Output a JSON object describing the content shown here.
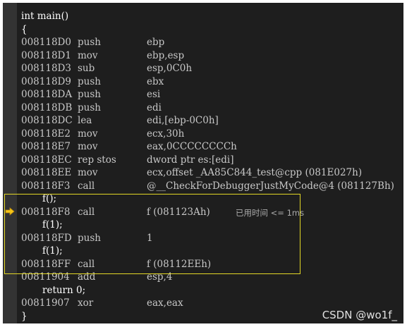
{
  "source_lines": {
    "main_sig": "int main()",
    "open_brace": "{",
    "call_f": "f();",
    "call_f1_a": "f(1);",
    "call_f1_b": "f(1);",
    "return": "return 0;",
    "close_brace": "}"
  },
  "asm": [
    {
      "addr": "008118D0",
      "op": "push",
      "args": "ebp"
    },
    {
      "addr": "008118D1",
      "op": "mov",
      "args": "ebp,esp"
    },
    {
      "addr": "008118D3",
      "op": "sub",
      "args": "esp,0C0h"
    },
    {
      "addr": "008118D9",
      "op": "push",
      "args": "ebx"
    },
    {
      "addr": "008118DA",
      "op": "push",
      "args": "esi"
    },
    {
      "addr": "008118DB",
      "op": "push",
      "args": "edi"
    },
    {
      "addr": "008118DC",
      "op": "lea",
      "args": "edi,[ebp-0C0h]"
    },
    {
      "addr": "008118E2",
      "op": "mov",
      "args": "ecx,30h"
    },
    {
      "addr": "008118E7",
      "op": "mov",
      "args": "eax,0CCCCCCCCh"
    },
    {
      "addr": "008118EC",
      "op": "rep stos",
      "args": "dword ptr es:[edi]"
    },
    {
      "addr": "008118EE",
      "op": "mov",
      "args": "ecx,offset _AA85C844_test@cpp (081E027h)"
    },
    {
      "addr": "008118F3",
      "op": "call",
      "args": "@__CheckForDebuggerJustMyCode@4 (081127Bh)"
    },
    {
      "addr": "008118F8",
      "op": "call",
      "args": "f (081123Ah)"
    },
    {
      "addr": "008118FD",
      "op": "push",
      "args": "1"
    },
    {
      "addr": "008118FF",
      "op": "call",
      "args": "f (08112EEh)"
    },
    {
      "addr": "00811904",
      "op": "add",
      "args": "esp,4"
    },
    {
      "addr": "00811907",
      "op": "xor",
      "args": "eax,eax"
    }
  ],
  "timing_label": "已用时间 <= 1ms",
  "watermark": "CSDN @wo1f_",
  "colors": {
    "background": "#1e1e1e",
    "gutter": "#333333",
    "highlight_border": "#e3d726",
    "instruction_pointer": "#f5c518"
  },
  "icons": {
    "instruction_pointer": "instruction-pointer-arrow-icon"
  }
}
